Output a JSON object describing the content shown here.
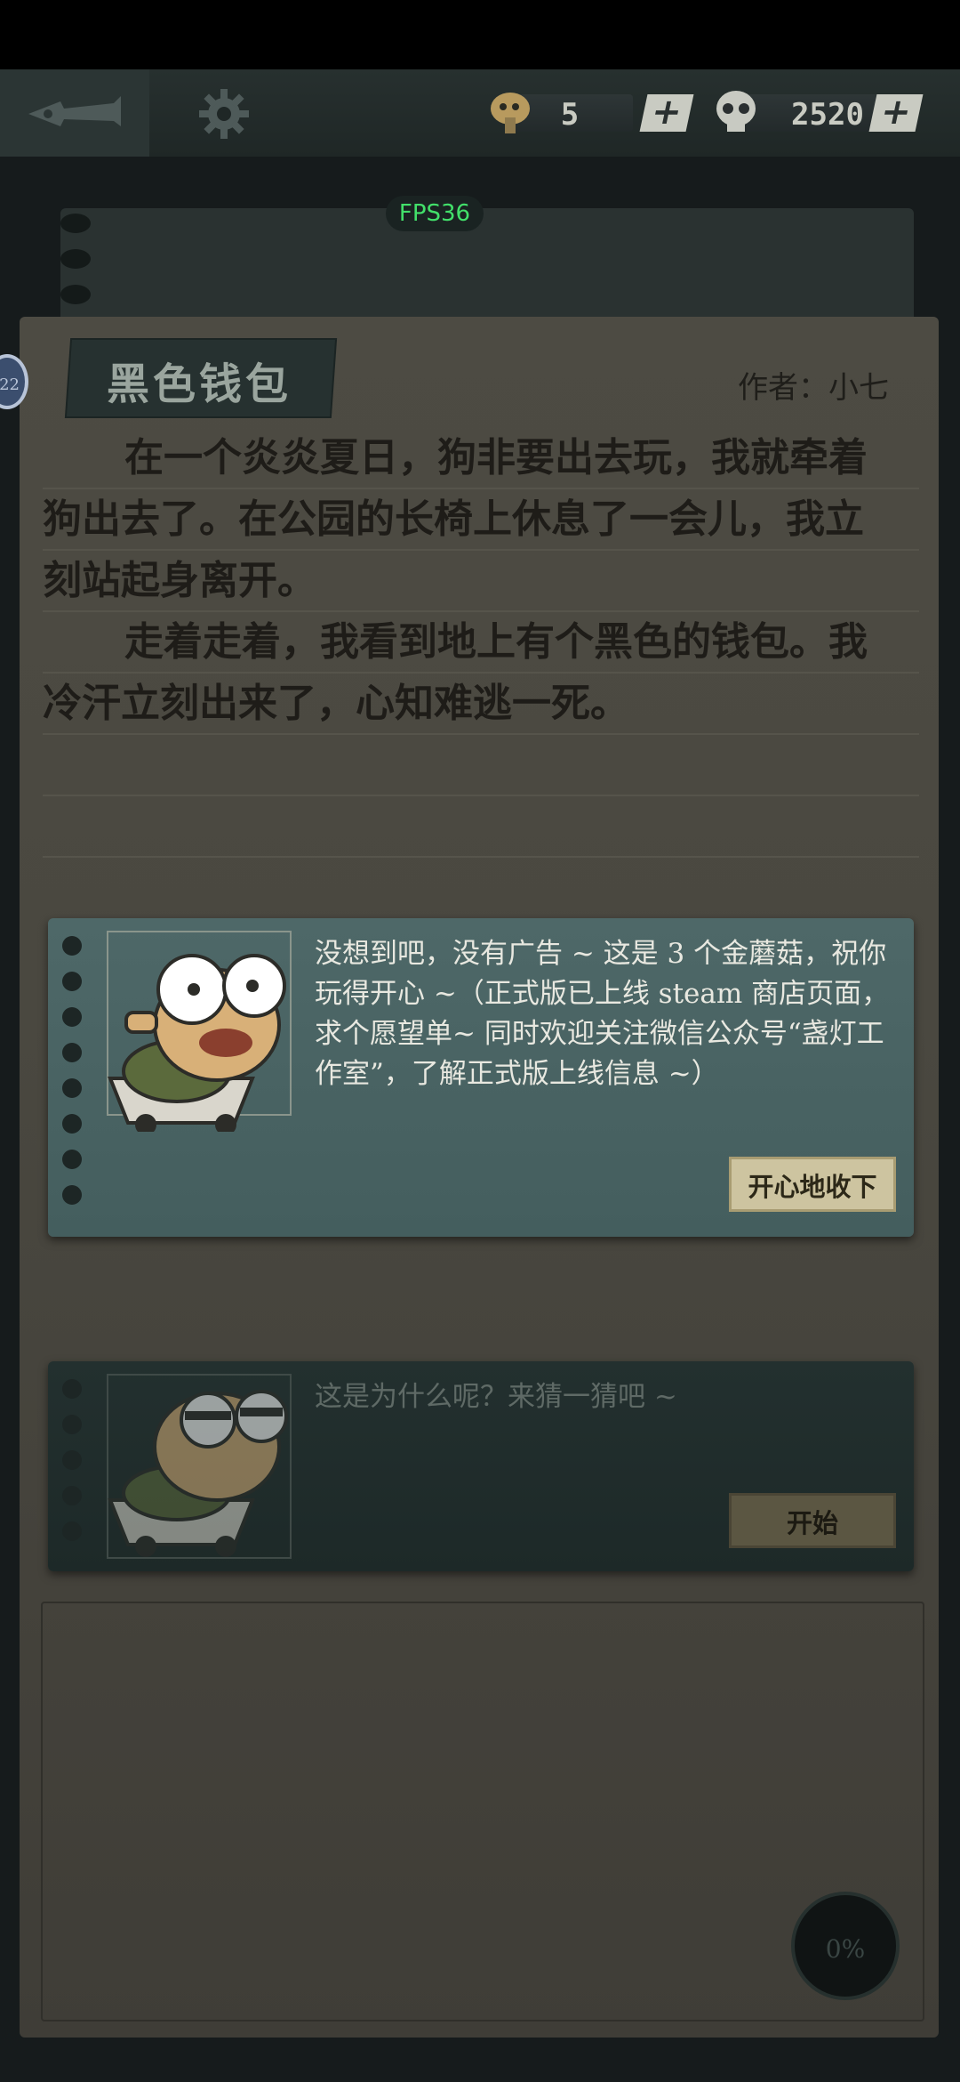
{
  "topbar": {
    "mushroom_count": "5",
    "skull_count": "2520",
    "plus_label": "+"
  },
  "fps_label": "FPS36",
  "story": {
    "title": "黑色钱包",
    "author": "作者：小七",
    "paragraphs": [
      "在一个炎炎夏日，狗非要出去玩，我就牵着狗出去了。在公园的长椅上休息了一会儿，我立刻站起身离开。",
      "走着走着，我看到地上有个黑色的钱包。我冷汗立刻出来了，心知难逃一死。"
    ]
  },
  "reward_card": {
    "message": "没想到吧，没有广告 ~ 这是 3 个金蘑菇，祝你玩得开心 ~（正式版已上线 steam 商店页面，求个愿望单~ 同时欢迎关注微信公众号“盏灯工作室”，了解正式版上线信息 ~）",
    "button_label": "开心地收下"
  },
  "guess_card": {
    "message": "这是为什么呢？来猜一猜吧 ~",
    "button_label": "开始"
  },
  "side_badge": "22",
  "progress_label": "0%",
  "colors": {
    "accent_green": "#42e06a",
    "card_teal": "#4e6868",
    "button_beige": "#cdc4a0"
  }
}
